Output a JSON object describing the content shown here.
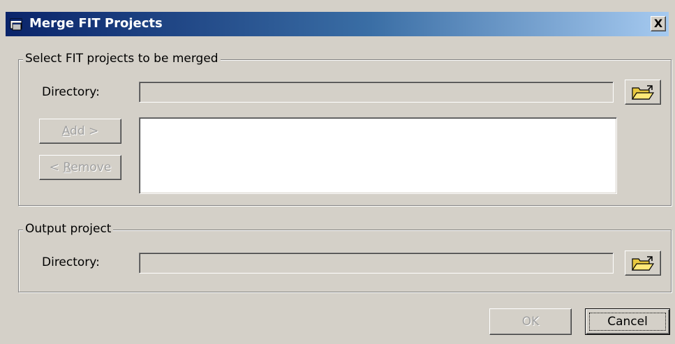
{
  "window": {
    "title": "Merge FIT Projects",
    "close_label": "X"
  },
  "select_group": {
    "legend": "Select FIT projects to be merged",
    "directory_label": "Directory:",
    "directory_value": "",
    "add_button": {
      "prefix": "",
      "mnemonic": "A",
      "rest": "dd >"
    },
    "remove_button": {
      "prefix": "< ",
      "mnemonic": "R",
      "rest": "emove"
    },
    "project_list": []
  },
  "output_group": {
    "legend": "Output project",
    "directory_label": "Directory:",
    "directory_value": ""
  },
  "footer": {
    "ok_label": "OK",
    "cancel_label": "Cancel"
  },
  "icons": {
    "title": "window-app-icon",
    "browse": "open-folder-icon"
  },
  "colors": {
    "title_gradient_start": "#0a246a",
    "title_gradient_end": "#a6caf0",
    "face": "#d4d0c8"
  }
}
